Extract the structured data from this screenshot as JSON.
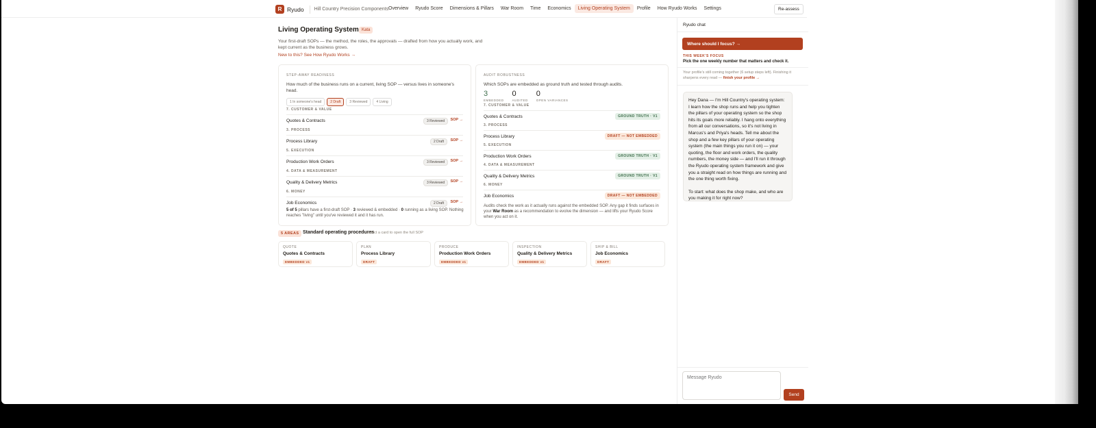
{
  "brand": {
    "logo_letter": "R",
    "name": "Ryudo",
    "company": "Hill Country Precision Components"
  },
  "nav": {
    "items": [
      "Overview",
      "Ryudo Score",
      "Dimensions & Pillars",
      "War Room",
      "Time",
      "Economics",
      "Living Operating System",
      "Profile",
      "How Ryudo Works",
      "Settings"
    ],
    "active": "Living Operating System",
    "reassess": "Re-assess"
  },
  "page": {
    "title": "Living Operating System",
    "badge": "Kata",
    "intro": "Your first-draft SOPs — the method, the roles, the approvals — drafted from how you actually work, and kept current as the business grows.",
    "intro_link": "New to this? See How Ryudo Works →"
  },
  "readiness": {
    "label": "STEP-AWAY READINESS",
    "desc": "How much of the business runs on a current, living SOP — versus lives in someone's head.",
    "stages": [
      "1 In someone's head",
      "2 Draft",
      "3 Reviewed",
      "4 Living"
    ],
    "active_stage": "2 Draft",
    "rows": [
      {
        "section": "7. CUSTOMER & VALUE",
        "name": "Quotes & Contracts",
        "pill": "3 Reviewed",
        "link": "SOP →"
      },
      {
        "section": "3. PROCESS",
        "name": "Process Library",
        "pill": "2 Draft",
        "link": "SOP →"
      },
      {
        "section": "5. EXECUTION",
        "name": "Production Work Orders",
        "pill": "3 Reviewed",
        "link": "SOP →"
      },
      {
        "section": "4. DATA & MEASUREMENT",
        "name": "Quality & Delivery Metrics",
        "pill": "3 Reviewed",
        "link": "SOP →"
      },
      {
        "section": "6. MONEY",
        "name": "Job Economics",
        "pill": "2 Draft",
        "link": "SOP →"
      }
    ],
    "summary_parts": {
      "a": "5 of 5",
      "b": " pillars have a first-draft SOP · ",
      "c": "3",
      "d": " reviewed & embedded · ",
      "e": "0",
      "f": " running as a living SOP. Nothing reaches \"living\" until you've reviewed it and it has run."
    }
  },
  "audit": {
    "label": "AUDIT ROBUSTNESS",
    "desc": "Which SOPs are embedded as ground truth and tested through audits.",
    "stats": [
      {
        "value": "3",
        "label": "EMBEDDED"
      },
      {
        "value": "0",
        "label": "AUDITED"
      },
      {
        "value": "0",
        "label": "OPEN VARIANCES"
      }
    ],
    "rows": [
      {
        "section": "7. CUSTOMER & VALUE",
        "name": "Quotes & Contracts",
        "tag": "GROUND TRUTH · V1",
        "kind": "truth"
      },
      {
        "section": "3. PROCESS",
        "name": "Process Library",
        "tag": "DRAFT — NOT EMBEDDED",
        "kind": "draft"
      },
      {
        "section": "5. EXECUTION",
        "name": "Production Work Orders",
        "tag": "GROUND TRUTH · V1",
        "kind": "truth"
      },
      {
        "section": "4. DATA & MEASUREMENT",
        "name": "Quality & Delivery Metrics",
        "tag": "GROUND TRUTH · V1",
        "kind": "truth"
      },
      {
        "section": "6. MONEY",
        "name": "Job Economics",
        "tag": "DRAFT — NOT EMBEDDED",
        "kind": "draft"
      }
    ],
    "note_parts": {
      "a": "Audits check the work as it actually runs against the embedded SOP. Any gap it finds surfaces in your ",
      "b": "War Room",
      "c": " as a recommendation to evolve the dimension — and lifts your Ryudo Score when you act on it."
    }
  },
  "areas": {
    "badge": "5 AREAS",
    "title": "Standard operating procedures",
    "subtitle": "select a card to open the full SOP",
    "cards": [
      {
        "category": "QUOTE",
        "name": "Quotes & Contracts",
        "tag": "EMBEDDED v1"
      },
      {
        "category": "PLAN",
        "name": "Process Library",
        "tag": "DRAFT"
      },
      {
        "category": "PRODUCE",
        "name": "Production Work Orders",
        "tag": "EMBEDDED v1"
      },
      {
        "category": "INSPECTION",
        "name": "Quality & Delivery Metrics",
        "tag": "EMBEDDED v1"
      },
      {
        "category": "SHIP & BILL",
        "name": "Job Economics",
        "tag": "DRAFT"
      }
    ]
  },
  "chat": {
    "title": "Ryudo chat",
    "focus_button": "Where should I focus? →",
    "week_label": "THIS WEEK'S FOCUS",
    "week_text": "Pick the one weekly number that matters and check it.",
    "profile_note": "Your profile's still coming together (6 setup steps left). Finishing it sharpens every read — ",
    "profile_link": "finish your profile →",
    "message_p1": "Hey Dana — I'm Hill Country's operating system: I learn how the shop runs and help you tighten the pillars of your operating system so the shop hits its goals more reliably. I hang onto everything from all our conversations, so it's not living in Marcus's and Priya's heads. Tell me about the shop and a few key pillars of your operating system (the main things you run it on) — your quoting, the floor and work orders, the quality numbers, the money side — and I'll run it through the Ryudo operating system framework and give you a straight read on how things are running and the one thing worth fixing.",
    "message_p2": "To start: what does the shop make, and who are you making it for right now?",
    "input_placeholder": "Message Ryudo",
    "send": "Send"
  }
}
